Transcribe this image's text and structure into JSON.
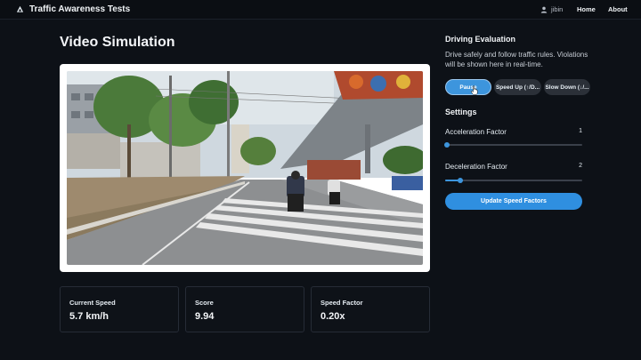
{
  "header": {
    "title": "Traffic Awareness Tests",
    "user": "jibin",
    "nav": [
      "Home",
      "About"
    ]
  },
  "main": {
    "title": "Video Simulation"
  },
  "stats": [
    {
      "label": "Current Speed",
      "value": "5.7 km/h"
    },
    {
      "label": "Score",
      "value": "9.94"
    },
    {
      "label": "Speed Factor",
      "value": "0.20x"
    }
  ],
  "evaluation": {
    "title": "Driving Evaluation",
    "description": "Drive safely and follow traffic rules. Violations will be shown here in real-time.",
    "buttons": {
      "pause": "Pause",
      "speed_up": "Speed Up (↑/D...",
      "slow_down": "Slow Down (↓/..."
    }
  },
  "settings": {
    "title": "Settings",
    "acceleration": {
      "label": "Acceleration Factor",
      "value": "1",
      "fraction": 0.0
    },
    "deceleration": {
      "label": "Deceleration Factor",
      "value": "2",
      "fraction": 0.11
    },
    "update_label": "Update Speed Factors"
  },
  "colors": {
    "accent": "#3d95dd",
    "background": "#0d1117"
  }
}
